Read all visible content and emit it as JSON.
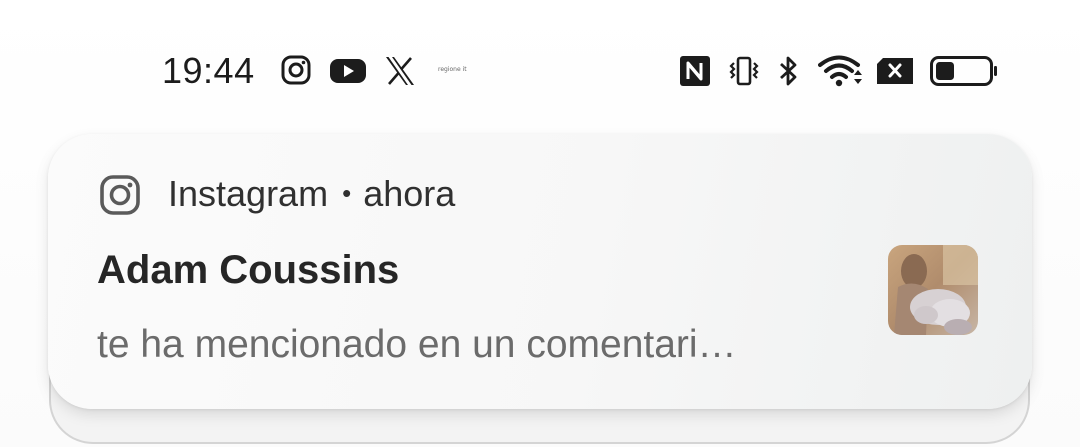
{
  "status_bar": {
    "time": "19:44",
    "left_icons": [
      "instagram-icon",
      "youtube-icon",
      "x-icon"
    ],
    "tiny_text": "regione it",
    "right_icons": [
      "nfc-icon",
      "vibrate-icon",
      "bluetooth-icon",
      "wifi-icon",
      "no-sim-icon",
      "battery-icon"
    ],
    "battery_level": 0.35
  },
  "notification": {
    "app_icon": "instagram-icon",
    "app_name": "Instagram",
    "separator": "•",
    "time": "ahora",
    "title": "Adam Coussins",
    "text": "te ha mencionado en un comentari…",
    "thumbnail": "photo-thumbnail"
  },
  "colors": {
    "card_background": "#f8f8f8",
    "text_primary": "#262626",
    "text_secondary": "#6b6b6b"
  }
}
